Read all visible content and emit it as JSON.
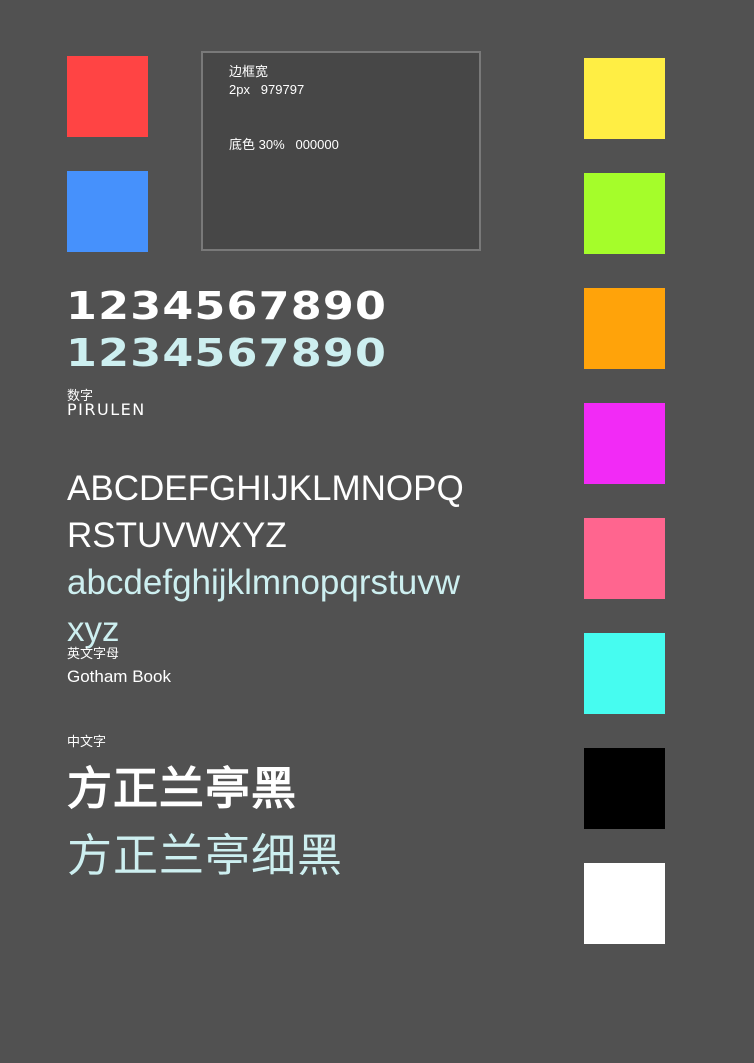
{
  "colors": {
    "page_bg": "#515151",
    "text_white": "#ffffff",
    "text_light_cyan": "#cdeff0",
    "border": "#797979"
  },
  "swatches_left": [
    {
      "name": "red",
      "color": "#ff4444"
    },
    {
      "name": "blue",
      "color": "#4691fc"
    }
  ],
  "swatches_right": [
    {
      "name": "yellow",
      "color": "#ffee44"
    },
    {
      "name": "lime",
      "color": "#a5fd2a"
    },
    {
      "name": "orange",
      "color": "#ffa30a"
    },
    {
      "name": "magenta",
      "color": "#f22af6"
    },
    {
      "name": "pink",
      "color": "#ff658f"
    },
    {
      "name": "cyan",
      "color": "#46fcf0"
    },
    {
      "name": "black",
      "color": "#000000"
    },
    {
      "name": "white",
      "color": "#ffffff"
    }
  ],
  "spec_box": {
    "border_label": "边框宽",
    "border_value": "2px   979797",
    "bg_label": "底色 30%   000000"
  },
  "numbers": {
    "line1": "1234567890",
    "line2": "1234567890",
    "label": "数字",
    "font": "PIRULEN"
  },
  "alphabet": {
    "upper1": "ABCDEFGHIJKLMNOPQ",
    "upper2": "RSTUVWXYZ",
    "lower1": "abcdefghijklmnopqrstuvw",
    "lower2": "xyz",
    "label": "英文字母",
    "font": "Gotham Book"
  },
  "chinese": {
    "label": "中文字",
    "bold_sample": "方正兰亭黑",
    "light_sample": "方正兰亭细黑"
  }
}
